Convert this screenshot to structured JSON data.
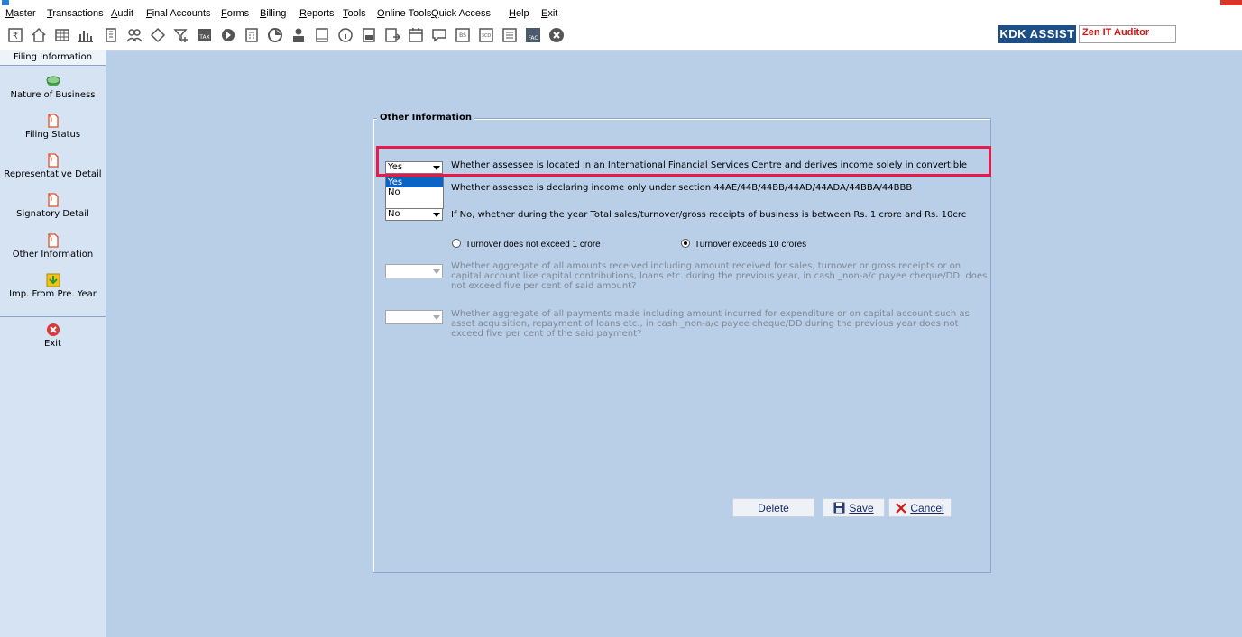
{
  "menu": [
    "Master",
    "Transactions",
    "Audit",
    "Final Accounts",
    "Forms",
    "Billing",
    "Reports",
    "Tools",
    "Online Tools",
    "Quick Access",
    "Help",
    "Exit"
  ],
  "toolbar": {
    "kdk_label": "KDK ASSIST",
    "zen_label": "Zen IT Auditor"
  },
  "sidebar": {
    "header": "Filing Information",
    "items": [
      {
        "label": "Nature of Business",
        "icon": "money-icon"
      },
      {
        "label": "Filing Status",
        "icon": "document-icon"
      },
      {
        "label": "Representative Detail",
        "icon": "document-icon"
      },
      {
        "label": "Signatory Detail",
        "icon": "document-icon"
      },
      {
        "label": "Other Information",
        "icon": "document-icon"
      },
      {
        "label": "Imp. From Pre. Year",
        "icon": "import-icon"
      },
      {
        "label": "Exit",
        "icon": "exit-icon"
      }
    ]
  },
  "panel": {
    "title": "Other Information",
    "q1": {
      "value": "Yes",
      "label": "Whether assessee is located in an International Financial Services Centre and derives income solely in convertible"
    },
    "dropdown_options": [
      "Yes",
      "No"
    ],
    "q2": {
      "label": "Whether assessee is declaring income only under section 44AE/44B/44BB/44AD/44ADA/44BBA/44BBB"
    },
    "q3": {
      "value": "No",
      "label": "If No, whether during the year Total sales/turnover/gross receipts of business is between Rs. 1 crore and Rs. 10crc"
    },
    "radio1": "Turnover does not exceed 1 crore",
    "radio2": "Turnover exceeds 10 crores",
    "q4": {
      "value": "",
      "label": "Whether aggregate of all amounts received including amount received for sales, turnover or gross receipts or on capital account  like capital contributions, loans etc. during the previous year, in cash _non-a/c payee cheque/DD, does not exceed five per cent of said amount?"
    },
    "q5": {
      "value": "",
      "label": "Whether aggregate of all payments made including amount incurred for expenditure or on capital account such as asset acquisition, repayment of loans etc., in cash _non-a/c payee cheque/DD during the previous year does not exceed five per cent of the said payment?"
    },
    "buttons": {
      "delete": "Delete",
      "save": "Save",
      "cancel": "Cancel"
    }
  },
  "colors": {
    "background": "#b9cfe8",
    "highlight": "#e8194f",
    "kdk": "#1d4f86"
  }
}
